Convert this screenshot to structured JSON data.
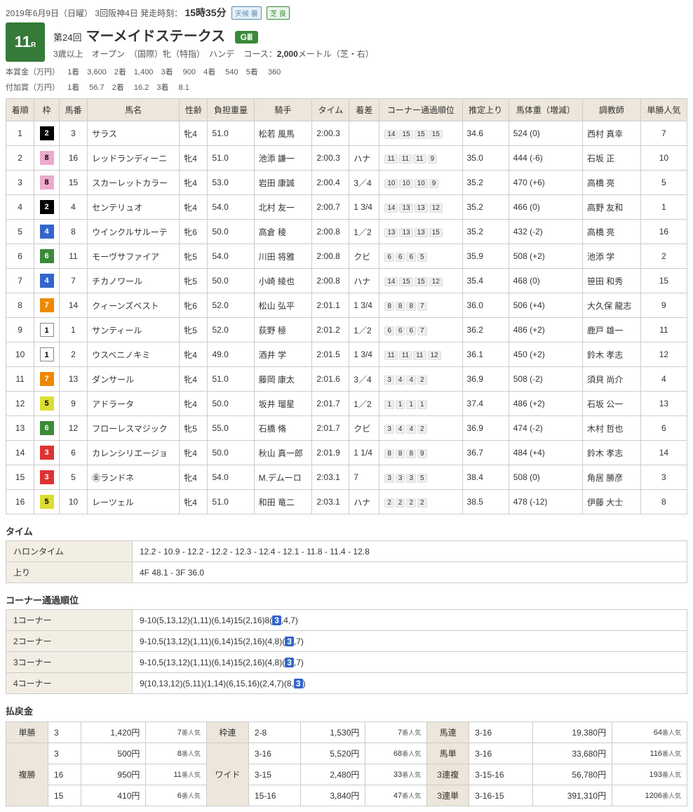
{
  "header": {
    "date_text": "2019年6月9日（日曜）",
    "meeting": "3回阪神4日",
    "start_label": "発走時刻：",
    "start_time": "15時35分",
    "weather_label": "天候",
    "weather_val": "曇",
    "turf_label": "芝",
    "turf_val": "良"
  },
  "race": {
    "number": "11",
    "number_suffix": "R",
    "kaiji": "第24回",
    "name": "マーメイドステークス",
    "grade": "GⅢ",
    "sub1": "3歳以上　オープン　（国際）牝（特指）　ハンデ",
    "course_label": "コース：",
    "course_val": "2,000",
    "course_unit": "メートル（芝・右）"
  },
  "prize": {
    "main_label": "本賞金（万円）",
    "main": [
      "1着　3,600",
      "2着　1,400",
      "3着　  900",
      "4着　  540",
      "5着　  360"
    ],
    "add_label": "付加賞（万円）",
    "add": [
      "1着　   56.7",
      "2着　   16.2",
      "3着　    8.1"
    ]
  },
  "columns": [
    "着順",
    "枠",
    "馬番",
    "馬名",
    "性齢",
    "負担重量",
    "騎手",
    "タイム",
    "着差",
    "コーナー通過順位",
    "推定上り",
    "馬体重（増減）",
    "調教師",
    "単勝人気"
  ],
  "results": [
    {
      "rank": "1",
      "waku": "2",
      "num": "3",
      "name": "サラス",
      "sexage": "牝4",
      "wgt": "51.0",
      "jockey": "松若 風馬",
      "time": "2:00.3",
      "margin": "",
      "corner": [
        "14",
        "15",
        "15",
        "15"
      ],
      "agari": "34.6",
      "body": "524 (0)",
      "trainer": "西村 真幸",
      "pop": "7"
    },
    {
      "rank": "2",
      "waku": "8",
      "num": "16",
      "name": "レッドランディーニ",
      "sexage": "牝4",
      "wgt": "51.0",
      "jockey": "池添 謙一",
      "time": "2:00.3",
      "margin": "ハナ",
      "corner": [
        "11",
        "11",
        "11",
        "9"
      ],
      "agari": "35.0",
      "body": "444 (-6)",
      "trainer": "石坂 正",
      "pop": "10"
    },
    {
      "rank": "3",
      "waku": "8",
      "num": "15",
      "name": "スカーレットカラー",
      "sexage": "牝4",
      "wgt": "53.0",
      "jockey": "岩田 康誠",
      "time": "2:00.4",
      "margin": "3／4",
      "corner": [
        "10",
        "10",
        "10",
        "9"
      ],
      "agari": "35.2",
      "body": "470 (+6)",
      "trainer": "高橋 亮",
      "pop": "5"
    },
    {
      "rank": "4",
      "waku": "2",
      "num": "4",
      "name": "センテリュオ",
      "sexage": "牝4",
      "wgt": "54.0",
      "jockey": "北村 友一",
      "time": "2:00.7",
      "margin": "1 3/4",
      "corner": [
        "14",
        "13",
        "13",
        "12"
      ],
      "agari": "35.2",
      "body": "466 (0)",
      "trainer": "高野 友和",
      "pop": "1"
    },
    {
      "rank": "5",
      "waku": "4",
      "num": "8",
      "name": "ウインクルサルーテ",
      "sexage": "牝6",
      "wgt": "50.0",
      "jockey": "高倉 稜",
      "time": "2:00.8",
      "margin": "1／2",
      "corner": [
        "13",
        "13",
        "13",
        "15"
      ],
      "agari": "35.2",
      "body": "432 (-2)",
      "trainer": "高橋 亮",
      "pop": "16"
    },
    {
      "rank": "6",
      "waku": "6",
      "num": "11",
      "name": "モーヴサファイア",
      "sexage": "牝5",
      "wgt": "54.0",
      "jockey": "川田 将雅",
      "time": "2:00.8",
      "margin": "クビ",
      "corner": [
        "6",
        "6",
        "6",
        "5"
      ],
      "agari": "35.9",
      "body": "508 (+2)",
      "trainer": "池添 学",
      "pop": "2"
    },
    {
      "rank": "7",
      "waku": "4",
      "num": "7",
      "name": "チカノワール",
      "sexage": "牝5",
      "wgt": "50.0",
      "jockey": "小崎 綾也",
      "time": "2:00.8",
      "margin": "ハナ",
      "corner": [
        "14",
        "15",
        "15",
        "12"
      ],
      "agari": "35.4",
      "body": "468 (0)",
      "trainer": "笹田 和秀",
      "pop": "15"
    },
    {
      "rank": "8",
      "waku": "7",
      "num": "14",
      "name": "クィーンズベスト",
      "sexage": "牝6",
      "wgt": "52.0",
      "jockey": "松山 弘平",
      "time": "2:01.1",
      "margin": "1 3/4",
      "corner": [
        "8",
        "8",
        "8",
        "7"
      ],
      "agari": "36.0",
      "body": "506 (+4)",
      "trainer": "大久保 龍志",
      "pop": "9"
    },
    {
      "rank": "9",
      "waku": "1",
      "num": "1",
      "name": "サンティール",
      "sexage": "牝5",
      "wgt": "52.0",
      "jockey": "荻野 極",
      "time": "2:01.2",
      "margin": "1／2",
      "corner": [
        "6",
        "6",
        "6",
        "7"
      ],
      "agari": "36.2",
      "body": "486 (+2)",
      "trainer": "鹿戸 雄一",
      "pop": "11"
    },
    {
      "rank": "10",
      "waku": "1",
      "num": "2",
      "name": "ウスベニノキミ",
      "sexage": "牝4",
      "wgt": "49.0",
      "jockey": "酒井 学",
      "time": "2:01.5",
      "margin": "1 3/4",
      "corner": [
        "11",
        "11",
        "11",
        "12"
      ],
      "agari": "36.1",
      "body": "450 (+2)",
      "trainer": "鈴木 孝志",
      "pop": "12"
    },
    {
      "rank": "11",
      "waku": "7",
      "num": "13",
      "name": "ダンサール",
      "sexage": "牝4",
      "wgt": "51.0",
      "jockey": "藤岡 康太",
      "time": "2:01.6",
      "margin": "3／4",
      "corner": [
        "3",
        "4",
        "4",
        "2"
      ],
      "agari": "36.9",
      "body": "508 (-2)",
      "trainer": "須貝 尚介",
      "pop": "4"
    },
    {
      "rank": "12",
      "waku": "5",
      "num": "9",
      "name": "アドラータ",
      "sexage": "牝4",
      "wgt": "50.0",
      "jockey": "坂井 瑠星",
      "time": "2:01.7",
      "margin": "1／2",
      "corner": [
        "1",
        "1",
        "1",
        "1"
      ],
      "agari": "37.4",
      "body": "486 (+2)",
      "trainer": "石坂 公一",
      "pop": "13"
    },
    {
      "rank": "13",
      "waku": "6",
      "num": "12",
      "name": "フローレスマジック",
      "sexage": "牝5",
      "wgt": "55.0",
      "jockey": "石橋 脩",
      "time": "2:01.7",
      "margin": "クビ",
      "corner": [
        "3",
        "4",
        "4",
        "2"
      ],
      "agari": "36.9",
      "body": "474 (-2)",
      "trainer": "木村 哲也",
      "pop": "6"
    },
    {
      "rank": "14",
      "waku": "3",
      "num": "6",
      "name": "カレンシリエージョ",
      "sexage": "牝4",
      "wgt": "50.0",
      "jockey": "秋山 真一郎",
      "time": "2:01.9",
      "margin": "1 1/4",
      "corner": [
        "8",
        "8",
        "8",
        "9"
      ],
      "agari": "36.7",
      "body": "484 (+4)",
      "trainer": "鈴木 孝志",
      "pop": "14"
    },
    {
      "rank": "15",
      "waku": "3",
      "num": "5",
      "name": "㊎ランドネ",
      "sexage": "牝4",
      "wgt": "54.0",
      "jockey": "M.デムーロ",
      "time": "2:03.1",
      "margin": "7",
      "corner": [
        "3",
        "3",
        "3",
        "5"
      ],
      "agari": "38.4",
      "body": "508 (0)",
      "trainer": "角居 勝彦",
      "pop": "3"
    },
    {
      "rank": "16",
      "waku": "5",
      "num": "10",
      "name": "レーツェル",
      "sexage": "牝4",
      "wgt": "51.0",
      "jockey": "和田 竜二",
      "time": "2:03.1",
      "margin": "ハナ",
      "corner": [
        "2",
        "2",
        "2",
        "2"
      ],
      "agari": "38.5",
      "body": "478 (-12)",
      "trainer": "伊藤 大士",
      "pop": "8"
    }
  ],
  "time_section": {
    "title": "タイム",
    "rows": [
      {
        "label": "ハロンタイム",
        "value": "12.2 - 10.9 - 12.2 - 12.2 - 12.3 - 12.4 - 12.1 - 11.8 - 11.4 - 12.8"
      },
      {
        "label": "上り",
        "value": "4F 48.1 - 3F 36.0"
      }
    ]
  },
  "corner_section": {
    "title": "コーナー通過順位",
    "rows": [
      {
        "label": "1コーナー",
        "pre": "9-10(5,13,12)(1,11)(6,14)15(2,16)8(",
        "hl": "3",
        "post": ",4,7)"
      },
      {
        "label": "2コーナー",
        "pre": "9-10,5(13,12)(1,11)(6,14)15(2,16)(4,8)(",
        "hl": "3",
        "post": ",7)"
      },
      {
        "label": "3コーナー",
        "pre": "9-10,5(13,12)(1,11)(6,14)15(2,16)(4,8)(",
        "hl": "3",
        "post": ",7)"
      },
      {
        "label": "4コーナー",
        "pre": "9(10,13,12)(5,11)(1,14)(6,15,16)(2,4,7)(8,",
        "hl": "3",
        "post": ")"
      }
    ]
  },
  "payout": {
    "title": "払戻金",
    "pop_suffix": "番人気",
    "blocks": [
      {
        "type": "単勝",
        "rows": [
          {
            "combo": "3",
            "amt": "1,420円",
            "pop": "7"
          }
        ]
      },
      {
        "type": "複勝",
        "rows": [
          {
            "combo": "3",
            "amt": "500円",
            "pop": "8"
          },
          {
            "combo": "16",
            "amt": "950円",
            "pop": "11"
          },
          {
            "combo": "15",
            "amt": "410円",
            "pop": "6"
          }
        ]
      },
      {
        "type": "枠連",
        "rows": [
          {
            "combo": "2-8",
            "amt": "1,530円",
            "pop": "7"
          }
        ]
      },
      {
        "type": "ワイド",
        "rows": [
          {
            "combo": "3-16",
            "amt": "5,520円",
            "pop": "68"
          },
          {
            "combo": "3-15",
            "amt": "2,480円",
            "pop": "33"
          },
          {
            "combo": "15-16",
            "amt": "3,840円",
            "pop": "47"
          }
        ]
      },
      {
        "type": "馬連",
        "rows": [
          {
            "combo": "3-16",
            "amt": "19,380円",
            "pop": "64"
          }
        ]
      },
      {
        "type": "馬単",
        "rows": [
          {
            "combo": "3-16",
            "amt": "33,680円",
            "pop": "116"
          }
        ]
      },
      {
        "type": "3連複",
        "rows": [
          {
            "combo": "3-15-16",
            "amt": "56,780円",
            "pop": "193"
          }
        ]
      },
      {
        "type": "3連単",
        "rows": [
          {
            "combo": "3-16-15",
            "amt": "391,310円",
            "pop": "1206"
          }
        ]
      }
    ]
  }
}
